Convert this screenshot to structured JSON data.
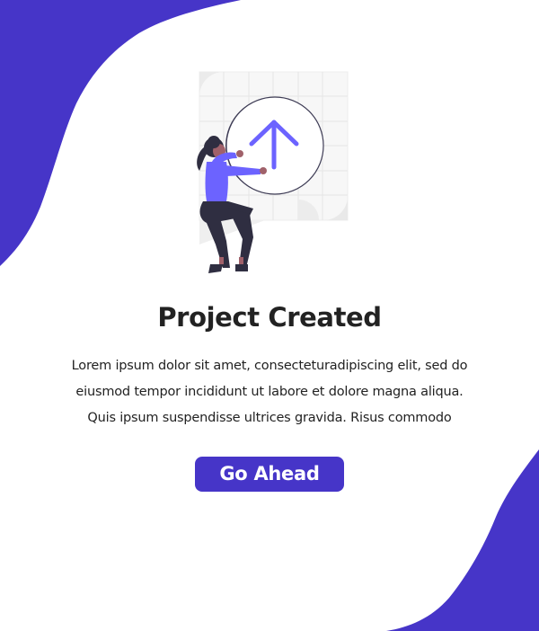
{
  "colors": {
    "accent": "#4635c8",
    "accent_light": "#6c63ff",
    "background": "#ffffff",
    "text": "#222222"
  },
  "illustration": {
    "icon": "upload-arrow-icon"
  },
  "title": "Project Created",
  "body_lines": [
    "Lorem ipsum dolor sit amet, consecteturadipiscing elit, sed do",
    "eiusmod tempor incididunt ut labore et dolore magna aliqua.",
    "Quis ipsum suspendisse ultrices gravida. Risus commodo"
  ],
  "button": {
    "label": "Go Ahead"
  }
}
